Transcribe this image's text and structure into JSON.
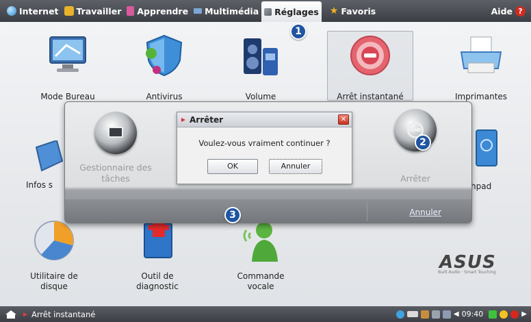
{
  "top_menu": {
    "tabs": [
      {
        "label": "Internet",
        "icon": "globe-icon",
        "color": "#4aa4e0"
      },
      {
        "label": "Travailler",
        "icon": "briefcase-icon",
        "color": "#e8b22a"
      },
      {
        "label": "Apprendre",
        "icon": "book-icon",
        "color": "#d95a9a"
      },
      {
        "label": "Multimédia",
        "icon": "film-icon",
        "color": "#7da6d8"
      },
      {
        "label": "Réglages",
        "icon": "wrench-icon",
        "color": "#8a8f96",
        "active": true
      },
      {
        "label": "Favoris",
        "icon": "star-icon",
        "color": "#f0b41e"
      }
    ],
    "help_label": "Aide",
    "help_icon": "help-icon"
  },
  "apps": {
    "row1": [
      "Mode Bureau",
      "Antivirus",
      "Volume",
      "Arrêt instantané",
      "Imprimantes"
    ],
    "row2_left": "Infos s",
    "row2_right": "hpad",
    "row3": [
      "Utilitaire de disque",
      "Outil de diagnostic",
      "Commande vocale"
    ]
  },
  "shutdown_overlay": {
    "left_label": "Gestionnaire des tâches",
    "right_label": "Arrêter",
    "cancel_label": "Annuler"
  },
  "dialog": {
    "title": "Arrêter",
    "message": "Voulez-vous vraiment continuer ?",
    "ok_label": "OK",
    "cancel_label": "Annuler",
    "close_glyph": "✕"
  },
  "callouts": [
    "1",
    "2",
    "3"
  ],
  "taskbar": {
    "active_task": "Arrêt instantané",
    "clock": "09:40"
  },
  "brand": {
    "logo": "ASUS",
    "tagline": "Built Audio · Smart Touching"
  },
  "colors": {
    "callout_blue": "#1f55a2",
    "close_red": "#c7321f",
    "topbar": "#45484e"
  }
}
